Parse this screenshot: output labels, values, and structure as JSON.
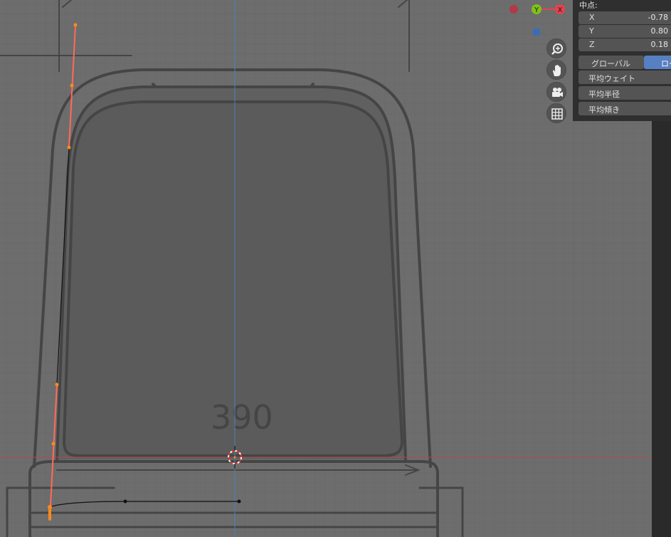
{
  "colors": {
    "viewport_bg": "#6d6d6d",
    "grid": "#656565",
    "reference_drawing": "#444444",
    "reference_fill": "#5e5e5e",
    "x_axis_line": "#b04a4a",
    "y_axis_line": "#4d82b8",
    "selected_curve": "#ff6a58",
    "vertex": "#ff8a1a",
    "panel_bg": "#2f2f2f",
    "field_bg": "#545454",
    "active_button": "#5680c2"
  },
  "drawing": {
    "dimension_text": "390"
  },
  "gizmo": {
    "y_label": "Y",
    "x_label": "X"
  },
  "nav": {
    "zoom_icon": "zoom-in-icon",
    "pan_icon": "hand-icon",
    "camera_icon": "camera-icon",
    "grid_icon": "grid-icon"
  },
  "panel": {
    "title": "中点:",
    "x_label": "X",
    "x_value": "-0.78",
    "y_label": "Y",
    "y_value": "0.80",
    "z_label": "Z",
    "z_value": "0.18",
    "global_label": "グローバル",
    "local_label": "ロー",
    "avg_weight": "平均ウェイト",
    "avg_radius": "平均半径",
    "avg_tilt": "平均傾き"
  }
}
